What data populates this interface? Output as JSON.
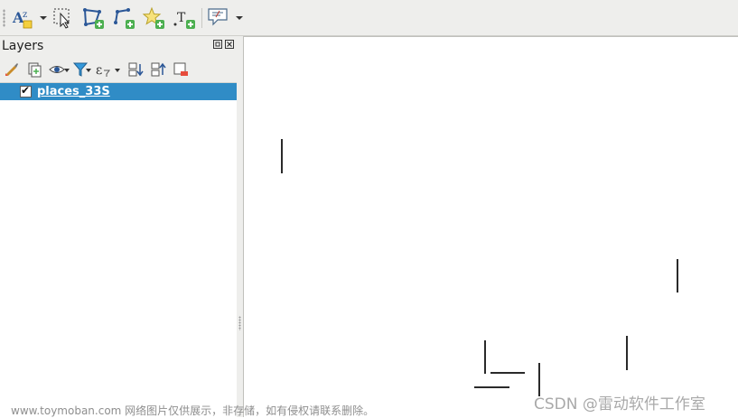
{
  "layers_panel": {
    "title": "Layers",
    "layers": [
      {
        "name": "places_33S",
        "checked": true,
        "selected": true
      }
    ]
  },
  "toolbar": {
    "icons": [
      "label-tool-icon",
      "select-features-icon",
      "add-polygon-icon",
      "add-line-icon",
      "add-point-icon",
      "add-text-annotation-icon",
      "map-tips-icon"
    ]
  },
  "colors": {
    "selection": "#308cc6",
    "panel_bg": "#eeeeec",
    "feature": "#2a2a2a"
  },
  "watermark": {
    "left": "www.toymoban.com 网络图片仅供展示，非存储，如有侵权请联系删除。",
    "right": "CSDN @雷动软件工作室"
  }
}
